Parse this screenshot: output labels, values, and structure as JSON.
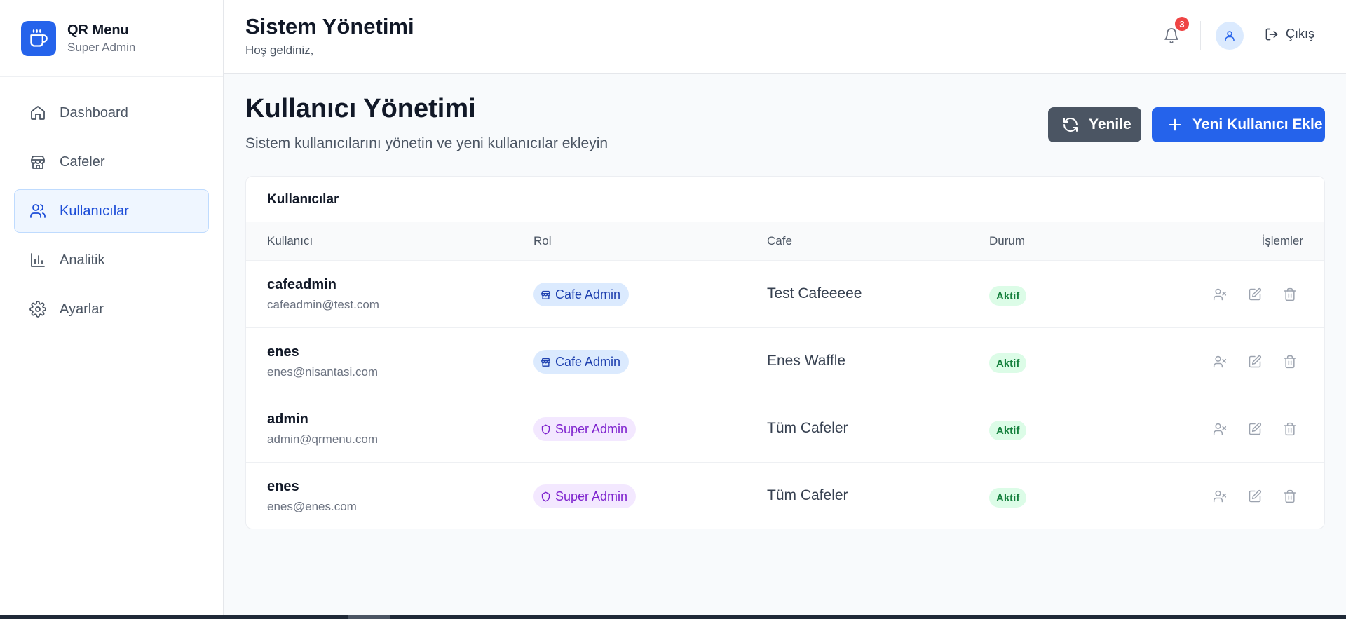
{
  "brand": {
    "title": "QR Menu",
    "subtitle": "Super Admin"
  },
  "sidebar": {
    "items": [
      {
        "label": "Dashboard",
        "icon": "home-icon"
      },
      {
        "label": "Cafeler",
        "icon": "store-icon"
      },
      {
        "label": "Kullanıcılar",
        "icon": "users-icon",
        "active": true
      },
      {
        "label": "Analitik",
        "icon": "bar-chart-icon"
      },
      {
        "label": "Ayarlar",
        "icon": "gear-icon"
      }
    ]
  },
  "header": {
    "title": "Sistem Yönetimi",
    "subtitle": "Hoş geldiniz,",
    "notification_count": "3",
    "logout_label": "Çıkış"
  },
  "main": {
    "title": "Kullanıcı Yönetimi",
    "description": "Sistem kullanıcılarını yönetin ve yeni kullanıcılar ekleyin",
    "refresh_label": "Yenile",
    "add_label": "Yeni Kullanıcı Ekle"
  },
  "table": {
    "title": "Kullanıcılar",
    "headers": {
      "user": "Kullanıcı",
      "role": "Rol",
      "cafe": "Cafe",
      "status": "Durum",
      "actions": "İşlemler"
    },
    "rows": [
      {
        "name": "cafeadmin",
        "email": "cafeadmin@test.com",
        "role": "Cafe Admin",
        "cafe": "Test Cafeeeee",
        "status": "Aktif"
      },
      {
        "name": "enes",
        "email": "enes@nisantasi.com",
        "role": "Cafe Admin",
        "cafe": "Enes Waffle",
        "status": "Aktif"
      },
      {
        "name": "admin",
        "email": "admin@qrmenu.com",
        "role": "Super Admin",
        "cafe": "Tüm Cafeler",
        "status": "Aktif"
      },
      {
        "name": "enes",
        "email": "enes@enes.com",
        "role": "Super Admin",
        "cafe": "Tüm Cafeler",
        "status": "Aktif"
      }
    ]
  },
  "colors": {
    "primary": "#2563eb",
    "refresh_button": "#4b5563",
    "cafe_admin_badge": "#dbeafe",
    "super_admin_badge": "#f3e8ff",
    "active_badge": "#dcfce7",
    "notification_badge": "#ef4444"
  }
}
